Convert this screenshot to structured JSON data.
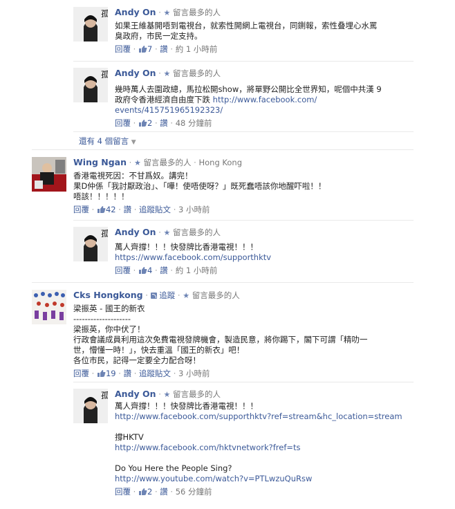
{
  "labels": {
    "reply": "回覆",
    "unlike": "讚",
    "follow_post": "追蹤貼文",
    "top_commenter": "留言最多的人",
    "follow": "追蹤",
    "more_replies": "還有 4 個留言"
  },
  "comments": [
    {
      "author": "Andy On",
      "lines": [
        "如果王維基開唔到電視台，就索性開網上電視台，同鍘報，索性叠埋心水罵",
        "臭政府，市民一定支持。"
      ],
      "likes": "7",
      "time": "約 1 小時前"
    },
    {
      "author": "Andy On",
      "lines": [
        "幾時萬人去圍政總，馬拉松開show，將單野公開比全世界知，呢個中共漢 9",
        "政府令香港經濟自由度下跌"
      ],
      "link": "http://www.facebook.com/",
      "link2": "events/415751965192323/",
      "likes": "2",
      "time": "48 分鐘前"
    },
    {
      "author": "Wing Ngan",
      "location": "Hong Kong",
      "lines": [
        "香港電視死因：不甘爲奴。講完！",
        "果D仲係「我討厭政治」、「嘩！使唔使呀？」既死蠢唔該你地醒吓啦！！",
        "唔該！！！！！"
      ],
      "likes": "42",
      "time": "3 小時前"
    },
    {
      "author": "Andy On",
      "lines": [
        "萬人齊撐！！！快發牌比香港電視！！！"
      ],
      "link": "https://www.facebook.com/supporthktv",
      "likes": "4",
      "time": "約 1 小時前"
    },
    {
      "author": "Cks Hongkong",
      "lines": [
        "梁振英 - 國王的新衣",
        "--------------------",
        "梁振英，你中伏了！",
        "行政會議成員利用這次免費電視發牌機會，製造民意，將你踢下，閣下可謂「精叻一",
        "世，懵懂一時！」，快去重溫「國王的新衣」吧！",
        "各位市民，記得一定要全力配合呀！"
      ],
      "likes": "19",
      "time": "3 小時前"
    },
    {
      "author": "Andy On",
      "line1": "萬人齊撐！！！快發牌比香港電視！！！",
      "link1": "http://www.facebook.com/supporthktv?ref=stream&hc_location=stream",
      "line2": "撐HKTV",
      "link2": "http://www.facebook.com/hktvnetwork?fref=ts",
      "line3": "Do You Here the People Sing?",
      "link3": "http://www.youtube.com/watch?v=PTLwzuQuRsw",
      "likes": "2",
      "time": "56 分鐘前"
    }
  ],
  "colors": {
    "link": "#3b5998",
    "meta": "#777777"
  }
}
